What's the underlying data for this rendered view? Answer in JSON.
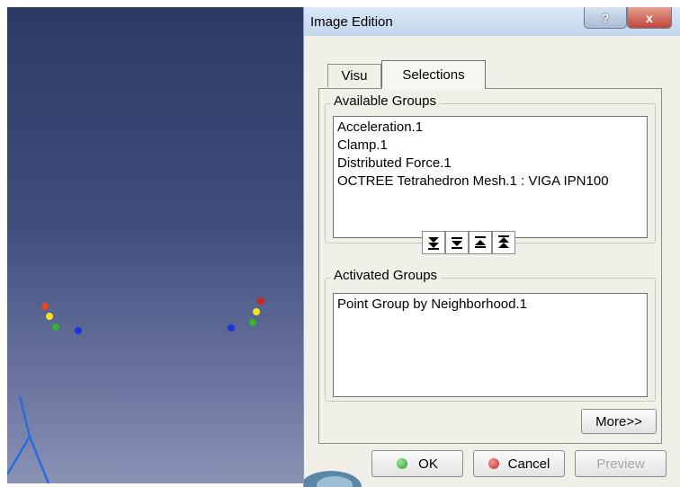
{
  "dialog": {
    "title": "Image Edition",
    "help_label": "?",
    "close_label": "x"
  },
  "tabs": [
    {
      "label": "Visu",
      "active": false
    },
    {
      "label": "Selections",
      "active": true
    }
  ],
  "available_groups": {
    "label": "Available Groups",
    "items": [
      "Acceleration.1",
      "Clamp.1",
      "Distributed Force.1",
      "OCTREE Tetrahedron Mesh.1 : VIGA IPN100"
    ]
  },
  "transfer_buttons": [
    {
      "icon": "add-all-icon",
      "glyph": "⯯"
    },
    {
      "icon": "add-icon",
      "glyph": "⯯"
    },
    {
      "icon": "remove-icon",
      "glyph": "⯭"
    },
    {
      "icon": "remove-all-icon",
      "glyph": "⯭"
    }
  ],
  "activated_groups": {
    "label": "Activated Groups",
    "items": [
      "Point Group by Neighborhood.1"
    ]
  },
  "buttons": {
    "more": "More>>",
    "ok": "OK",
    "cancel": "Cancel",
    "preview": "Preview"
  },
  "colors": {
    "ok_icon": "#2e9c2e",
    "cancel_icon": "#c62828",
    "preview_disabled_text": "#a8a8a8",
    "viewport_top": "#2c3a63",
    "viewport_bottom": "#8a92b5"
  },
  "viewport_points": [
    {
      "color": "#e8451c"
    },
    {
      "color": "#f2e21a"
    },
    {
      "color": "#31b531"
    },
    {
      "color": "#1d35e0"
    },
    {
      "color": "#d42020"
    },
    {
      "color": "#f2e21a"
    },
    {
      "color": "#31b531"
    },
    {
      "color": "#1d35e0"
    }
  ]
}
